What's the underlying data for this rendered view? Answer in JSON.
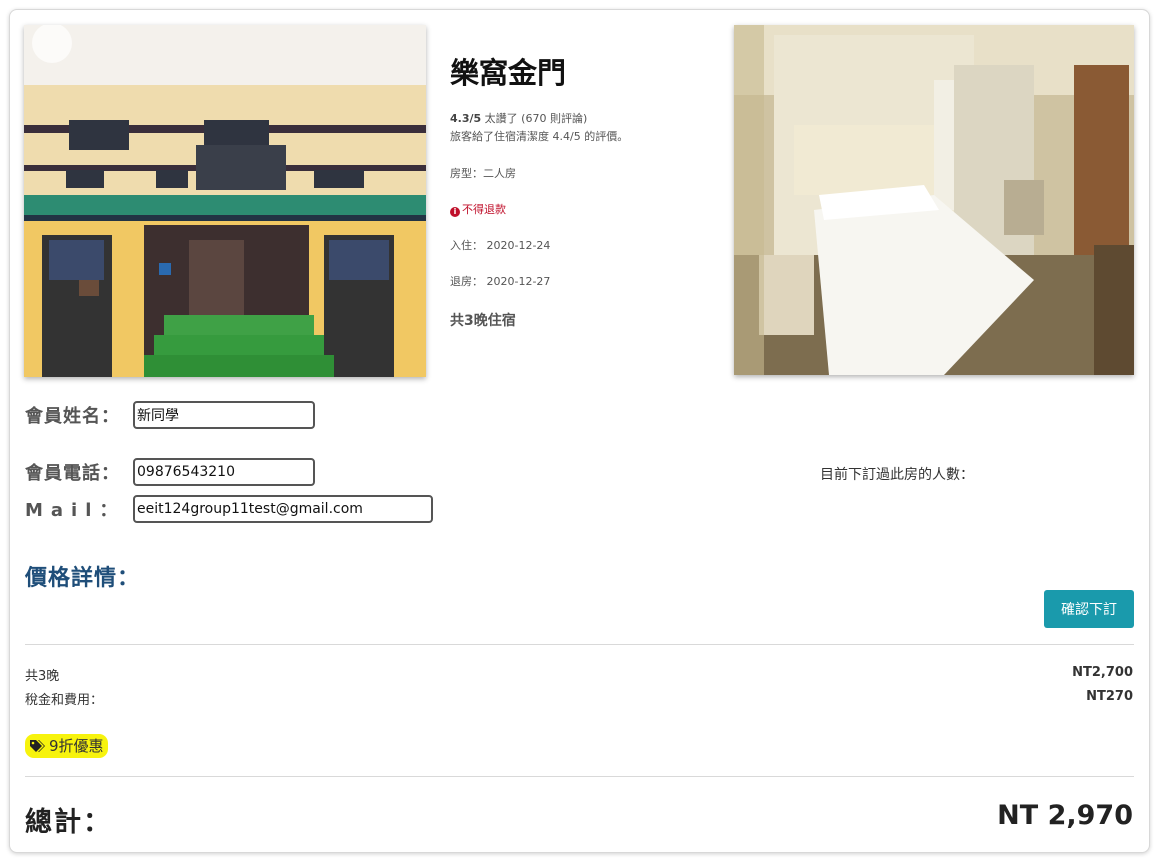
{
  "hotel": {
    "name": "樂窩金門",
    "rating_score": "4.3/5",
    "rating_text": " 太讚了 (670 則評論)",
    "cleanliness": "旅客給了住宿清潔度 4.4/5 的評價。",
    "room_type": "房型：二人房",
    "refund_policy": "不得退款",
    "checkin": "入住： 2020-12-24",
    "checkout": "退房： 2020-12-27",
    "nights_total": "共3晚住宿"
  },
  "form": {
    "name_label": "會員姓名：",
    "name_value": "新同學",
    "phone_label": "會員電話：",
    "phone_value": "09876543210",
    "mail_label": "Mail：",
    "mail_value": "eeit124group11test@gmail.com",
    "booked_count_label": "目前下訂過此房的人數："
  },
  "price": {
    "section_title": "價格詳情：",
    "confirm_button": "確認下訂",
    "nights_label": "共3晚",
    "nights_value": "NT2,700",
    "tax_label": "稅金和費用：",
    "tax_value": "NT270",
    "discount_badge": "9折優惠",
    "total_label": "總計：",
    "total_value": "NT 2,970"
  },
  "icons": {
    "refund": "info-circle-icon",
    "discount": "tags-icon"
  },
  "colors": {
    "refund": "#c0102b",
    "section_title": "#1f4e79",
    "confirm_button": "#1a9aac",
    "discount_badge": "#f7f30d"
  }
}
